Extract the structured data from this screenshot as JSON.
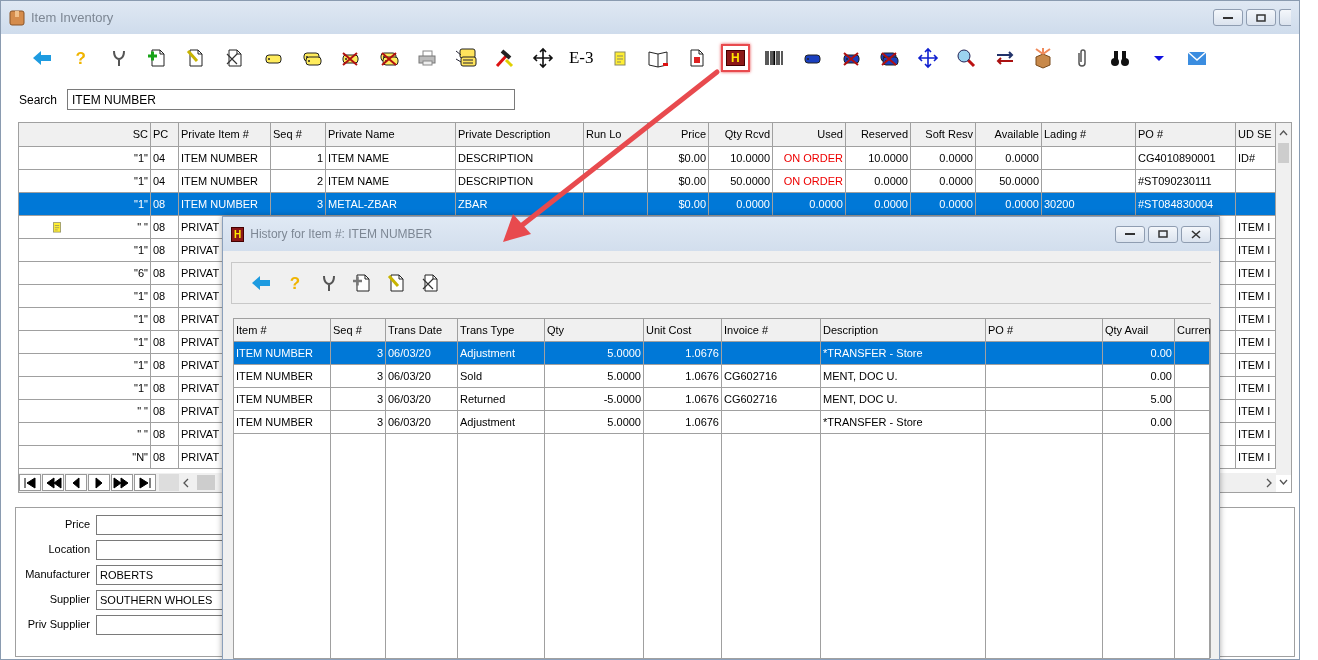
{
  "window": {
    "title": "Item Inventory"
  },
  "toolbar": {
    "help_glyph": "?",
    "text_tool": "E-3",
    "history_glyph": "H",
    "history_highlighted": true
  },
  "search": {
    "label": "Search",
    "value": "ITEM NUMBER"
  },
  "grid": {
    "columns": [
      "SC",
      "PC",
      "Private Item #",
      "Seq #",
      "Private Name",
      "Private Description",
      "Run Lo",
      "Price",
      "Qty Rcvd",
      "Used",
      "Reserved",
      "Soft Resv",
      "Available",
      "Lading #",
      "PO #",
      "UD SE"
    ],
    "rows": [
      {
        "sc": "\"1\"",
        "pc": "04",
        "item": "ITEM NUMBER",
        "seq": "1",
        "name": "ITEM NAME",
        "desc": "DESCRIPTION",
        "price": "$0.00",
        "qty_rcvd": "10.0000",
        "used": "ON ORDER",
        "used_alert": true,
        "reserved": "10.0000",
        "soft_resv": "0.0000",
        "available": "0.0000",
        "po": "CG4010890001",
        "ud": "ID#",
        "has_note": false,
        "selected": false
      },
      {
        "sc": "\"1\"",
        "pc": "04",
        "item": "ITEM NUMBER",
        "seq": "2",
        "name": "ITEM NAME",
        "desc": "DESCRIPTION",
        "price": "$0.00",
        "qty_rcvd": "50.0000",
        "used": "ON ORDER",
        "used_alert": true,
        "reserved": "0.0000",
        "soft_resv": "0.0000",
        "available": "50.0000",
        "po": "#ST090230111",
        "has_note": false,
        "selected": false
      },
      {
        "sc": "\"1\"",
        "pc": "08",
        "item": "ITEM NUMBER",
        "seq": "3",
        "name": "METAL-ZBAR",
        "desc": "ZBAR",
        "price": "$0.00",
        "qty_rcvd": "0.0000",
        "used": "0.0000",
        "used_alert": false,
        "reserved": "0.0000",
        "soft_resv": "0.0000",
        "available": "0.0000",
        "lading": "30200",
        "po": "#ST084830004",
        "has_note": false,
        "selected": true
      },
      {
        "sc": "\" \"",
        "pc": "08",
        "item": "PRIVAT",
        "ud": "ITEM I",
        "has_note": true,
        "selected": false
      },
      {
        "sc": "\"1\"",
        "pc": "08",
        "item": "PRIVAT",
        "ud": "ITEM I",
        "has_note": false,
        "selected": false
      },
      {
        "sc": "\"6\"",
        "pc": "08",
        "item": "PRIVAT",
        "ud": "ITEM I",
        "has_note": false,
        "selected": false
      },
      {
        "sc": "\"1\"",
        "pc": "08",
        "item": "PRIVAT",
        "ud": "ITEM I",
        "has_note": false,
        "selected": false
      },
      {
        "sc": "\"1\"",
        "pc": "08",
        "item": "PRIVAT",
        "ud": "ITEM I",
        "has_note": false,
        "selected": false
      },
      {
        "sc": "\"1\"",
        "pc": "08",
        "item": "PRIVAT",
        "ud": "ITEM I",
        "has_note": false,
        "selected": false
      },
      {
        "sc": "\"1\"",
        "pc": "08",
        "item": "PRIVAT",
        "ud": "ITEM I",
        "has_note": false,
        "selected": false
      },
      {
        "sc": "\"1\"",
        "pc": "08",
        "item": "PRIVAT",
        "ud": "ITEM I",
        "has_note": false,
        "selected": false
      },
      {
        "sc": "\" \"",
        "pc": "08",
        "item": "PRIVAT",
        "ud": "ITEM I",
        "has_note": false,
        "selected": false
      },
      {
        "sc": "\" \"",
        "pc": "08",
        "item": "PRIVAT",
        "ud": "ITEM I",
        "has_note": false,
        "selected": false
      },
      {
        "sc": "\"N\"",
        "pc": "08",
        "item": "PRIVAT",
        "ud": "ITEM I",
        "has_note": false,
        "selected": false
      }
    ]
  },
  "form": [
    {
      "label": "Price"
    },
    {
      "label": "Location"
    },
    {
      "label": "Manufacturer",
      "value": "ROBERTS"
    },
    {
      "label": "Supplier",
      "value": "SOUTHERN WHOLES"
    },
    {
      "label": "Priv Supplier"
    }
  ],
  "history": {
    "title": "History for Item #: ITEM NUMBER",
    "icon_glyph": "H",
    "help_glyph": "?",
    "columns": [
      "Item #",
      "Seq #",
      "Trans Date",
      "Trans Type",
      "Qty",
      "Unit Cost",
      "Invoice #",
      "Description",
      "PO #",
      "Qty Avail",
      "Curren"
    ],
    "rows": [
      {
        "item": "ITEM NUMBER",
        "seq": "3",
        "date": "06/03/20",
        "type": "Adjustment",
        "qty": "5.0000",
        "unit_cost": "1.0676",
        "description": "*TRANSFER - Store",
        "qty_avail": "0.00",
        "selected": true
      },
      {
        "item": "ITEM NUMBER",
        "seq": "3",
        "date": "06/03/20",
        "type": "Sold",
        "qty": "5.0000",
        "unit_cost": "1.0676",
        "invoice": "CG602716",
        "description": "MENT, DOC U.",
        "qty_avail": "0.00",
        "selected": false
      },
      {
        "item": "ITEM NUMBER",
        "seq": "3",
        "date": "06/03/20",
        "type": "Returned",
        "qty": "-5.0000",
        "unit_cost": "1.0676",
        "invoice": "CG602716",
        "description": "MENT, DOC U.",
        "qty_avail": "5.00",
        "selected": false
      },
      {
        "item": "ITEM NUMBER",
        "seq": "3",
        "date": "06/03/20",
        "type": "Adjustment",
        "qty": "5.0000",
        "unit_cost": "1.0676",
        "description": "*TRANSFER - Store",
        "qty_avail": "0.00",
        "selected": false
      }
    ]
  }
}
